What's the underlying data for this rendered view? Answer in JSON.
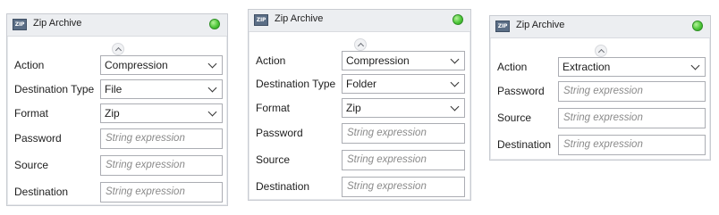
{
  "panels": [
    {
      "title": "Zip Archive",
      "icon_text": "ZIP",
      "status_color": "#4fc83a",
      "fields": [
        {
          "label": "Action",
          "value": "Compression"
        },
        {
          "label": "Destination Type",
          "value": "File"
        },
        {
          "label": "Format",
          "value": "Zip"
        },
        {
          "label": "Password",
          "placeholder": "String expression"
        },
        {
          "label": "Source",
          "placeholder": "String expression"
        },
        {
          "label": "Destination",
          "placeholder": "String expression"
        }
      ]
    },
    {
      "title": "Zip Archive",
      "icon_text": "ZIP",
      "status_color": "#4fc83a",
      "fields": [
        {
          "label": "Action",
          "value": "Compression"
        },
        {
          "label": "Destination Type",
          "value": "Folder"
        },
        {
          "label": "Format",
          "value": "Zip"
        },
        {
          "label": "Password",
          "placeholder": "String expression"
        },
        {
          "label": "Source",
          "placeholder": "String expression"
        },
        {
          "label": "Destination",
          "placeholder": "String expression"
        }
      ]
    },
    {
      "title": "Zip Archive",
      "icon_text": "ZIP",
      "status_color": "#4fc83a",
      "fields": [
        {
          "label": "Action",
          "value": "Extraction"
        },
        {
          "label": "Password",
          "placeholder": "String expression"
        },
        {
          "label": "Source",
          "placeholder": "String expression"
        },
        {
          "label": "Destination",
          "placeholder": "String expression"
        }
      ]
    }
  ]
}
